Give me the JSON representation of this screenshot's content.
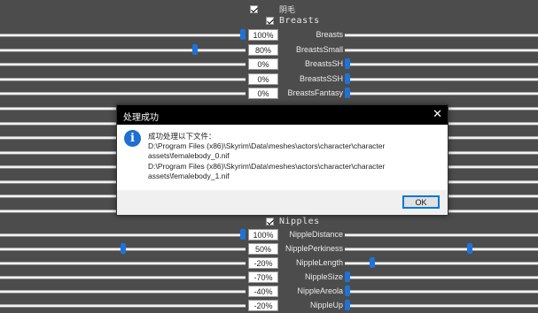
{
  "window": {
    "partial_left_title": "·············",
    "partial_right_title": "·············"
  },
  "categories": [
    {
      "label": "阴毛",
      "checked": true
    },
    {
      "label": "Breasts",
      "checked": true
    },
    {
      "label": "Nipples",
      "checked": true
    }
  ],
  "sliders_top": [
    {
      "name": "Breasts",
      "value": "100%",
      "left_pos": 1.0,
      "right_pos": null
    },
    {
      "name": "BreastsSmall",
      "value": "80%",
      "left_pos": 0.8,
      "right_pos": null
    },
    {
      "name": "BreastsSH",
      "value": "0%",
      "left_pos": null,
      "right_pos": 0.0
    },
    {
      "name": "BreastsSSH",
      "value": "0%",
      "left_pos": null,
      "right_pos": 0.0
    },
    {
      "name": "BreastsFantasy",
      "value": "0%",
      "left_pos": null,
      "right_pos": 0.0
    }
  ],
  "sliders_bottom": [
    {
      "name": "NippleDistance",
      "value": "100%",
      "left_pos": 1.0,
      "right_pos": null
    },
    {
      "name": "NipplePerkiness",
      "value": "50%",
      "left_pos": 0.5,
      "right_pos": 0.65
    },
    {
      "name": "NippleLength",
      "value": "-20%",
      "left_pos": null,
      "right_pos": 0.13
    },
    {
      "name": "NippleSize",
      "value": "-70%",
      "left_pos": null,
      "right_pos": 0.0
    },
    {
      "name": "NippleAreola",
      "value": "-40%",
      "left_pos": null,
      "right_pos": 0.0
    },
    {
      "name": "NippleUp",
      "value": "-20%",
      "left_pos": null,
      "right_pos": 0.0
    }
  ],
  "dialog": {
    "title": "处理成功",
    "close": "✕",
    "icon": "i",
    "message_lines": [
      "成功处理以下文件：",
      "D:\\Program Files (x86)\\Skyrim\\Data\\meshes\\actors\\character\\character",
      "assets\\femalebody_0.nif",
      "D:\\Program Files (x86)\\Skyrim\\Data\\meshes\\actors\\character\\character",
      "assets\\femalebody_1.nif"
    ],
    "ok_label": "OK"
  },
  "colors": {
    "background": "#4c4c4c",
    "thumb": "#1e73d8",
    "dialog_titlebar": "#000000",
    "ok_border": "#0078d7"
  }
}
